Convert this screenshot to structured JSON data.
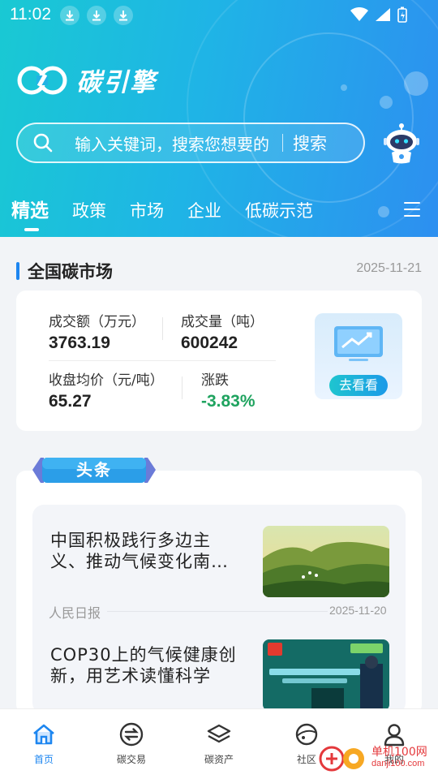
{
  "status": {
    "time": "11:02"
  },
  "app": {
    "name": "碳引擎"
  },
  "search": {
    "placeholder": "输入关键词，搜索您想要的",
    "button": "搜索"
  },
  "tabs": [
    {
      "label": "精选",
      "active": true
    },
    {
      "label": "政策",
      "active": false
    },
    {
      "label": "市场",
      "active": false
    },
    {
      "label": "企业",
      "active": false
    },
    {
      "label": "低碳示范",
      "active": false
    }
  ],
  "market": {
    "title": "全国碳市场",
    "date": "2025-11-21",
    "turnover_label": "成交额（万元）",
    "turnover_value": "3763.19",
    "volume_label": "成交量（吨）",
    "volume_value": "600242",
    "avg_price_label": "收盘均价（元/吨）",
    "avg_price_value": "65.27",
    "change_label": "涨跌",
    "change_value": "-3.83%",
    "goto_label": "去看看"
  },
  "headlines": {
    "section_label": "头条",
    "items": [
      {
        "title_line1": "中国积极践行多边主",
        "title_line2": "义、推动气候变化南…",
        "source": "人民日报",
        "date": "2025-11-20"
      },
      {
        "title_line1": "COP30上的气候健康创",
        "title_line2": "新，用艺术读懂科学",
        "source": "",
        "date": ""
      }
    ]
  },
  "bottom_nav": [
    {
      "label": "首页",
      "active": true,
      "icon": "home-icon"
    },
    {
      "label": "碳交易",
      "active": false,
      "icon": "exchange-icon"
    },
    {
      "label": "碳资产",
      "active": false,
      "icon": "layers-icon"
    },
    {
      "label": "社区",
      "active": false,
      "icon": "planet-icon"
    },
    {
      "label": "我的",
      "active": false,
      "icon": "user-icon"
    }
  ],
  "watermark": {
    "text": "单机100网",
    "url": "danji100.com"
  },
  "colors": {
    "accent": "#1d86f0",
    "header_start": "#19c9d3",
    "header_end": "#2d8ff0",
    "change": "#1fa35f"
  }
}
